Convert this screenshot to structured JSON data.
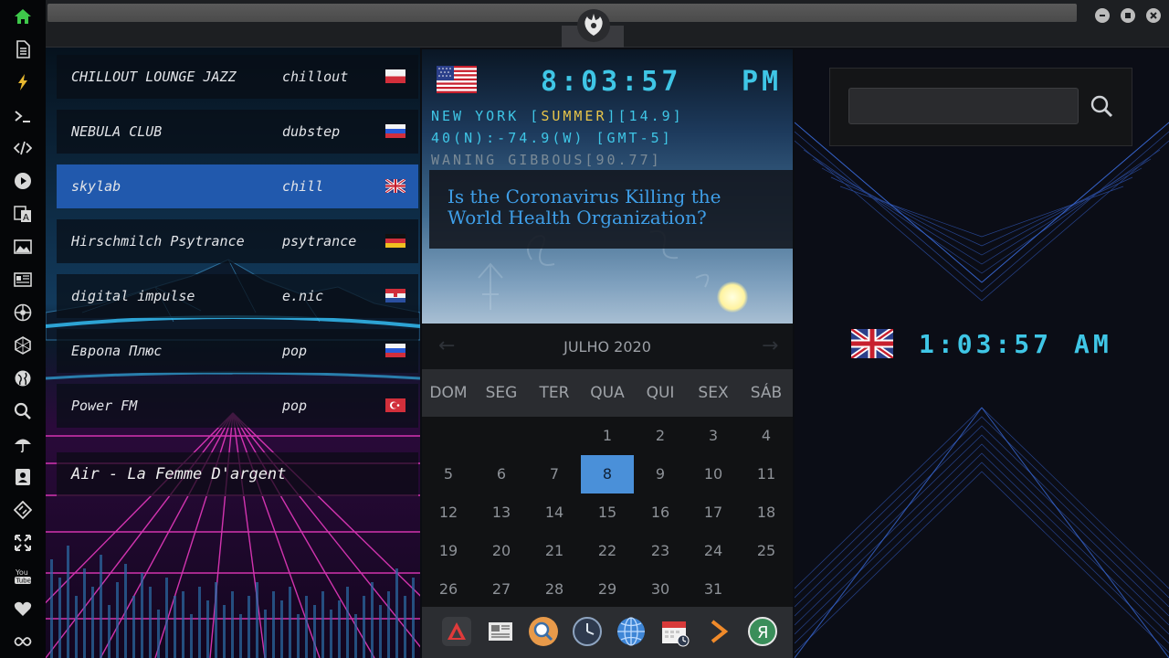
{
  "sidebar": {
    "icons": [
      "home-icon",
      "document-icon",
      "bolt-icon",
      "terminal-icon",
      "code-icon",
      "play-icon",
      "translate-icon",
      "image-icon",
      "news-icon",
      "aperture-icon",
      "hexagon-icon",
      "globe-icon",
      "search-icon",
      "umbrella-icon",
      "contact-icon",
      "tag-icon",
      "fullscreen-icon",
      "youtube-icon",
      "heart-icon",
      "infinity-icon"
    ],
    "accent_home": "#3ec84a",
    "accent_bolt": "#e8b830"
  },
  "radio": {
    "stations": [
      {
        "name": "CHILLOUT LOUNGE JAZZ",
        "genre": "chillout",
        "flag": "poland"
      },
      {
        "name": "NEBULA CLUB",
        "genre": "dubstep",
        "flag": "russia"
      },
      {
        "name": "skylab",
        "genre": "chill",
        "flag": "uk"
      },
      {
        "name": "Hirschmilch Psytrance",
        "genre": "psytrance",
        "flag": "germany"
      },
      {
        "name": "digital impulse",
        "genre": "e.nic",
        "flag": "croatia"
      },
      {
        "name": "Европа Плюс",
        "genre": "pop",
        "flag": "russia"
      },
      {
        "name": "Power FM",
        "genre": "pop",
        "flag": "turkey"
      }
    ],
    "now_playing": "Air - La Femme D'argent",
    "active_color": "#2159ad"
  },
  "clock": {
    "time": "8:03:57",
    "ampm": "PM",
    "city_prefix": "NEW YORK [",
    "season": "SUMMER",
    "city_suffix": "][14.9]",
    "coords": "40(N):-74.9(W) [GMT-5]",
    "moon": "WANING GIBBOUS[90.77]"
  },
  "news": {
    "headline": "Is the Coronavirus Killing the World Health Organization?"
  },
  "calendar": {
    "month": "JULHO 2020",
    "prev": "←",
    "next": "→",
    "weekdays": [
      "DOM",
      "SEG",
      "TER",
      "QUA",
      "QUI",
      "SEX",
      "SÁB"
    ],
    "first_weekday_index": 3,
    "days_in_month": 31,
    "today": 8
  },
  "dock": {
    "icons": [
      "arrow-app-icon",
      "newspaper-icon",
      "magnifier-icon",
      "clock-icon",
      "globe-icon",
      "calendar-icon",
      "forward-icon",
      "yandex-icon"
    ]
  },
  "world_clock": {
    "time": "1:03:57",
    "ampm": "AM"
  },
  "search": {
    "placeholder": ""
  },
  "colors": {
    "digital": "#3fc6e6",
    "season": "#e8c54a",
    "headline": "#3f9fe8",
    "today": "#4a90d9"
  }
}
